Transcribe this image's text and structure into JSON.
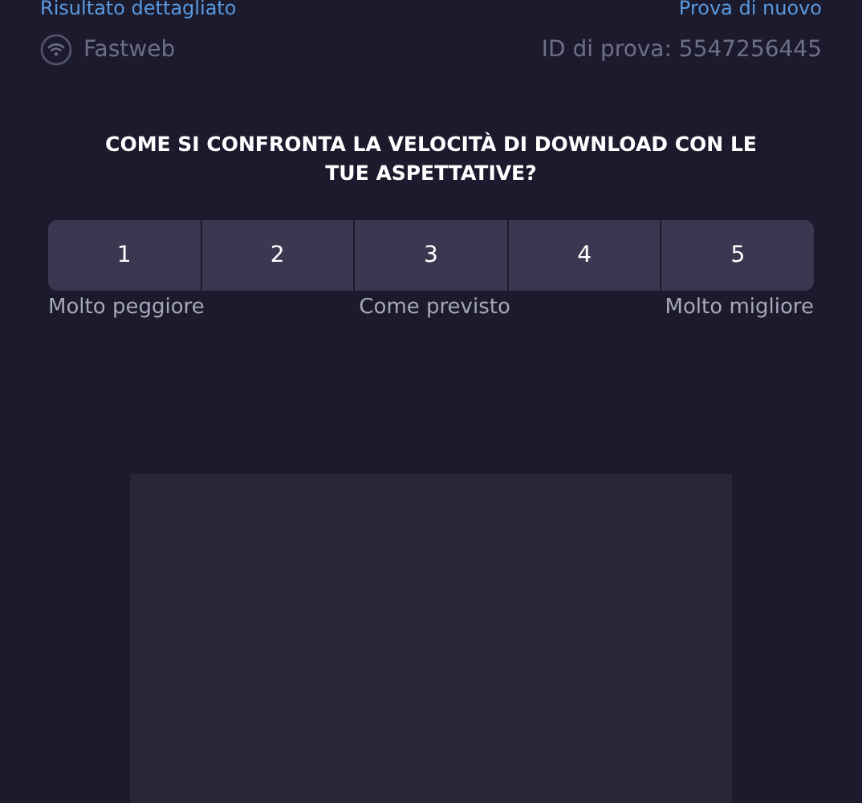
{
  "top_links": {
    "left": "Risultato dettagliato",
    "right": "Prova di nuovo"
  },
  "info": {
    "provider": "Fastweb",
    "test_id": "ID di prova: 5547256445"
  },
  "question": "COME SI CONFRONTA LA VELOCITÀ DI DOWNLOAD CON LE TUE ASPETTATIVE?",
  "ratings": [
    {
      "label": "1",
      "selected": false
    },
    {
      "label": "2",
      "selected": false
    },
    {
      "label": "3",
      "selected": false
    },
    {
      "label": "4",
      "selected": false
    },
    {
      "label": "5",
      "selected": false
    }
  ],
  "scale_labels": [
    "Molto peggiore",
    "Come previsto",
    "Molto migliore"
  ]
}
